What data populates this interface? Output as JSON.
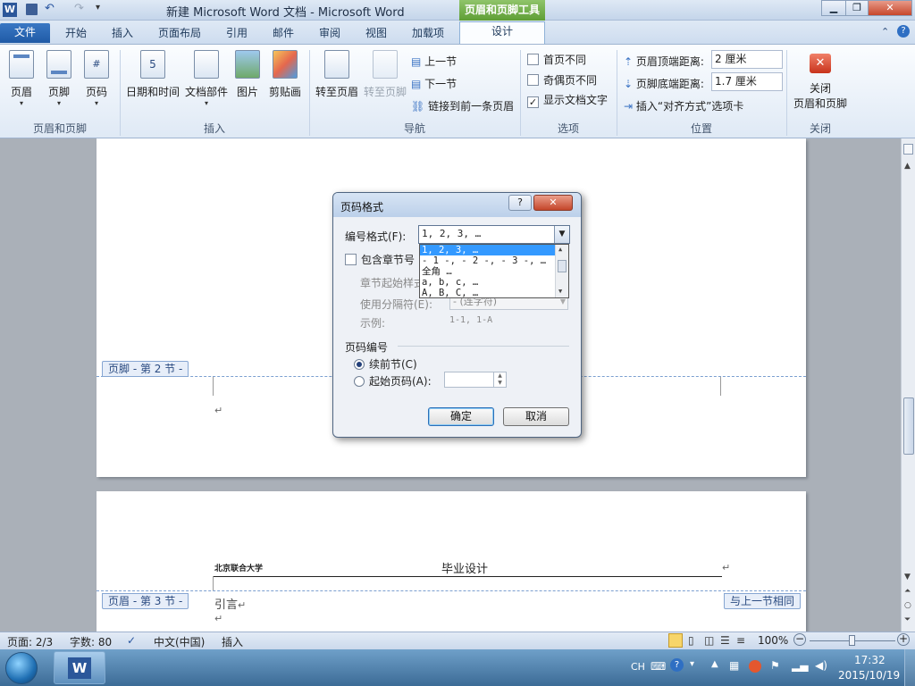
{
  "app": {
    "window_title": "新建 Microsoft Word 文档  -  Microsoft Word",
    "context_tab": "页眉和页脚工具",
    "word_logo": "W"
  },
  "tabs": [
    "文件",
    "开始",
    "插入",
    "页面布局",
    "引用",
    "邮件",
    "审阅",
    "视图",
    "加载项",
    "设计"
  ],
  "ribbon": {
    "hf_group": {
      "label": "页眉和页脚",
      "buttons": [
        "页眉",
        "页脚",
        "页码"
      ]
    },
    "insert_group": {
      "label": "插入",
      "buttons": [
        "日期和时间",
        "文档部件",
        "图片",
        "剪贴画"
      ]
    },
    "nav_group": {
      "label": "导航",
      "goto_header": "转至页眉",
      "goto_footer": "转至页脚",
      "prev": "上一节",
      "next": "下一节",
      "link": "链接到前一条页眉"
    },
    "options_group": {
      "label": "选项",
      "first_page": "首页不同",
      "odd_even": "奇偶页不同",
      "show_text": "显示文档文字",
      "show_text_checked": true
    },
    "position_group": {
      "label": "位置",
      "header_top": "页眉顶端距离:",
      "header_top_value": "2 厘米",
      "footer_bottom": "页脚底端距离:",
      "footer_bottom_value": "1.7 厘米",
      "insert_align": "插入“对齐方式”选项卡"
    },
    "close_group": {
      "label": "关闭",
      "button_line1": "关闭",
      "button_line2": "页眉和页脚"
    }
  },
  "document": {
    "footer_tag": "页脚 - 第 2 节 -",
    "header_tag": "页眉 - 第 3 节 -",
    "same_as_prev": "与上一节相同",
    "school": "北京联合大学",
    "header_title": "毕业设计",
    "body_text": "引言",
    "para_mark": "↵"
  },
  "dialog": {
    "title": "页码格式",
    "help": "?",
    "close": "✕",
    "format_label": "编号格式(F):",
    "format_value": "1, 2, 3, …",
    "format_options": [
      "1, 2, 3, …",
      "- 1 -, - 2 -, - 3 -, …",
      "全角 …",
      "a, b, c, …",
      "A, B, C, …"
    ],
    "include_chapter": "包含章节号",
    "chapter_style": "章节起始样式",
    "separator": "使用分隔符(E):",
    "separator_value": "-  (连字符)",
    "example_label": "示例:",
    "example_value": "1-1, 1-A",
    "numbering_section": "页码编号",
    "continue_prev": "续前节(C)",
    "start_at": "起始页码(A):",
    "ok": "确定",
    "cancel": "取消"
  },
  "status": {
    "page": "页面: 2/3",
    "words": "字数: 80",
    "language": "中文(中国)",
    "mode": "插入",
    "zoom": "100%"
  },
  "taskbar": {
    "lang": "CH",
    "time": "17:32",
    "date": "2015/10/19"
  }
}
